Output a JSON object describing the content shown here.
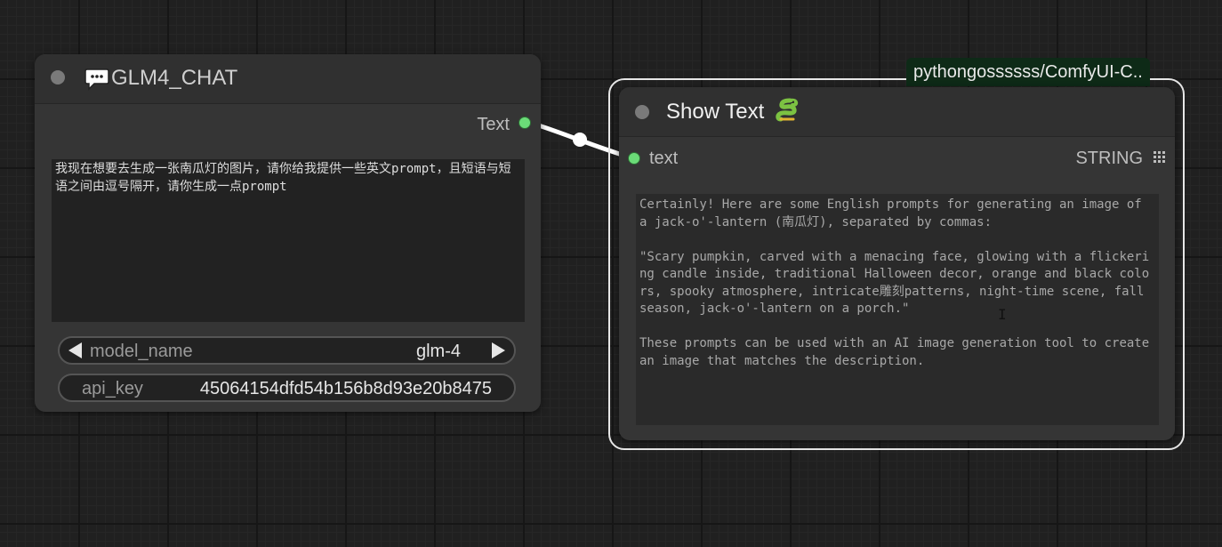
{
  "glm_node": {
    "title": "GLM4_CHAT",
    "title_icon": "speech-bubble-icon",
    "output_label": "Text",
    "prompt_text": "我现在想要去生成一张南瓜灯的图片，请你给我提供一些英文prompt，且短语与短语之间由逗号隔开，请你生成一点prompt",
    "model_widget": {
      "label": "model_name",
      "value": "glm-4"
    },
    "api_widget": {
      "label": "api_key",
      "value": "45064154dfd54b156b8d93e20b8475"
    }
  },
  "show_node": {
    "badge": "pythongossssss/ComfyUI-C..",
    "title": "Show Text",
    "title_icon": "snake-icon",
    "input_label": "text",
    "output_type": "STRING",
    "output_text": "Certainly! Here are some English prompts for generating an image of a jack-o'-lantern (南瓜灯), separated by commas:\n\n\"Scary pumpkin, carved with a menacing face, glowing with a flickering candle inside, traditional Halloween decor, orange and black colors, spooky atmosphere, intricate雕刻patterns, night-time scene, fall season, jack-o'-lantern on a porch.\"\n\nThese prompts can be used with an AI image generation tool to create an image that matches the description."
  },
  "colors": {
    "socket_green": "#6bdc78",
    "badge_bg": "#0e2a17",
    "link": "#ffffff"
  }
}
